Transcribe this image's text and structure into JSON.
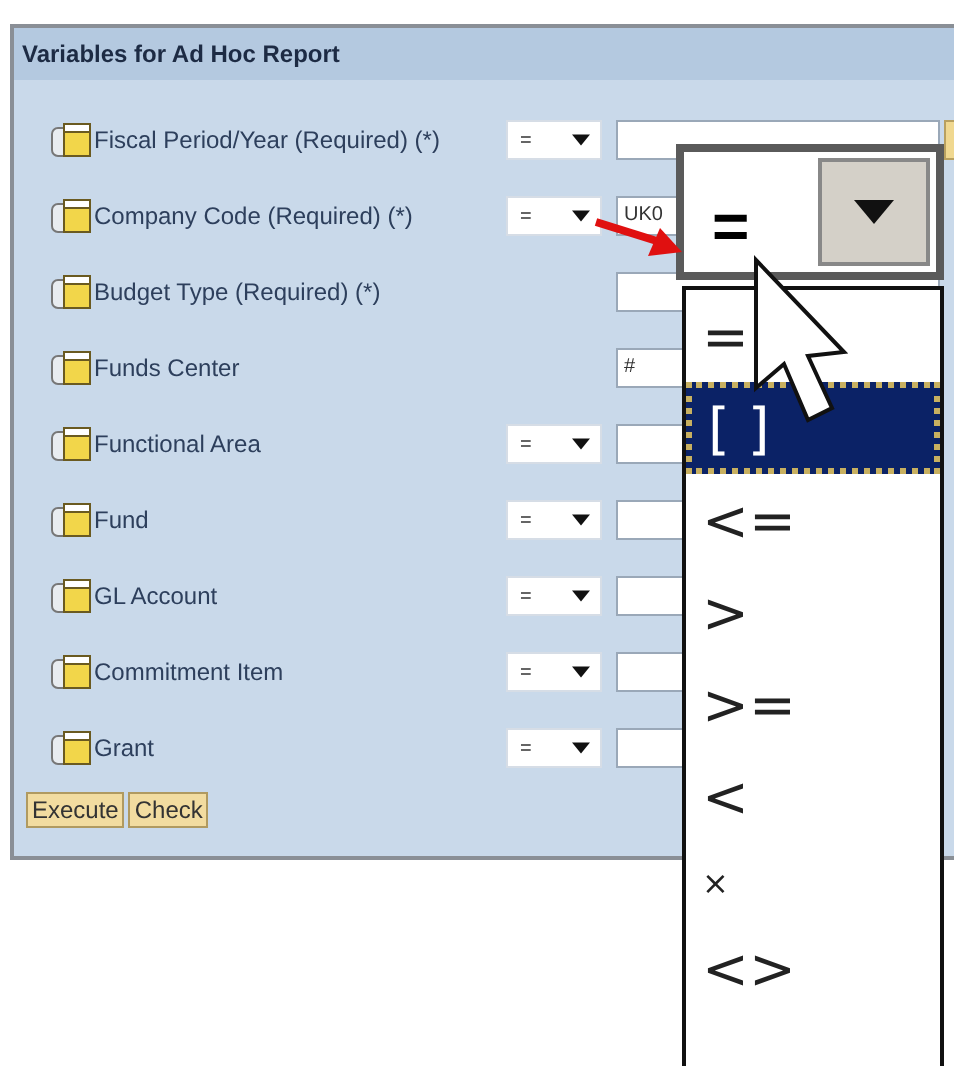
{
  "panel": {
    "title": "Variables for Ad Hoc Report",
    "rows": [
      {
        "label": "Fiscal Period/Year (Required) (*)",
        "operator": "=",
        "value_help": true
      },
      {
        "label": "Company Code (Required) (*)",
        "operator": "=",
        "value": "UK0"
      },
      {
        "label": "Budget Type (Required) (*)"
      },
      {
        "label": "Funds Center",
        "value": "#"
      },
      {
        "label": "Functional Area",
        "operator": "="
      },
      {
        "label": "Fund",
        "operator": "="
      },
      {
        "label": "GL Account",
        "operator": "="
      },
      {
        "label": "Commitment Item",
        "operator": "="
      },
      {
        "label": "Grant",
        "operator": "="
      }
    ],
    "buttons": [
      "Execute",
      "Check"
    ]
  },
  "callout": {
    "operator_value": "=",
    "options": [
      {
        "label": "=",
        "selected": false,
        "kind": "option"
      },
      {
        "label": "[ ]",
        "selected": true,
        "kind": "option"
      },
      {
        "label": "<=",
        "selected": false,
        "kind": "option"
      },
      {
        "label": ">",
        "selected": false,
        "kind": "option"
      },
      {
        "label": ">=",
        "selected": false,
        "kind": "option"
      },
      {
        "label": "<",
        "selected": false,
        "kind": "option"
      },
      {
        "label": "×",
        "selected": false,
        "kind": "small"
      },
      {
        "label": "<>",
        "selected": false,
        "kind": "option"
      }
    ]
  }
}
